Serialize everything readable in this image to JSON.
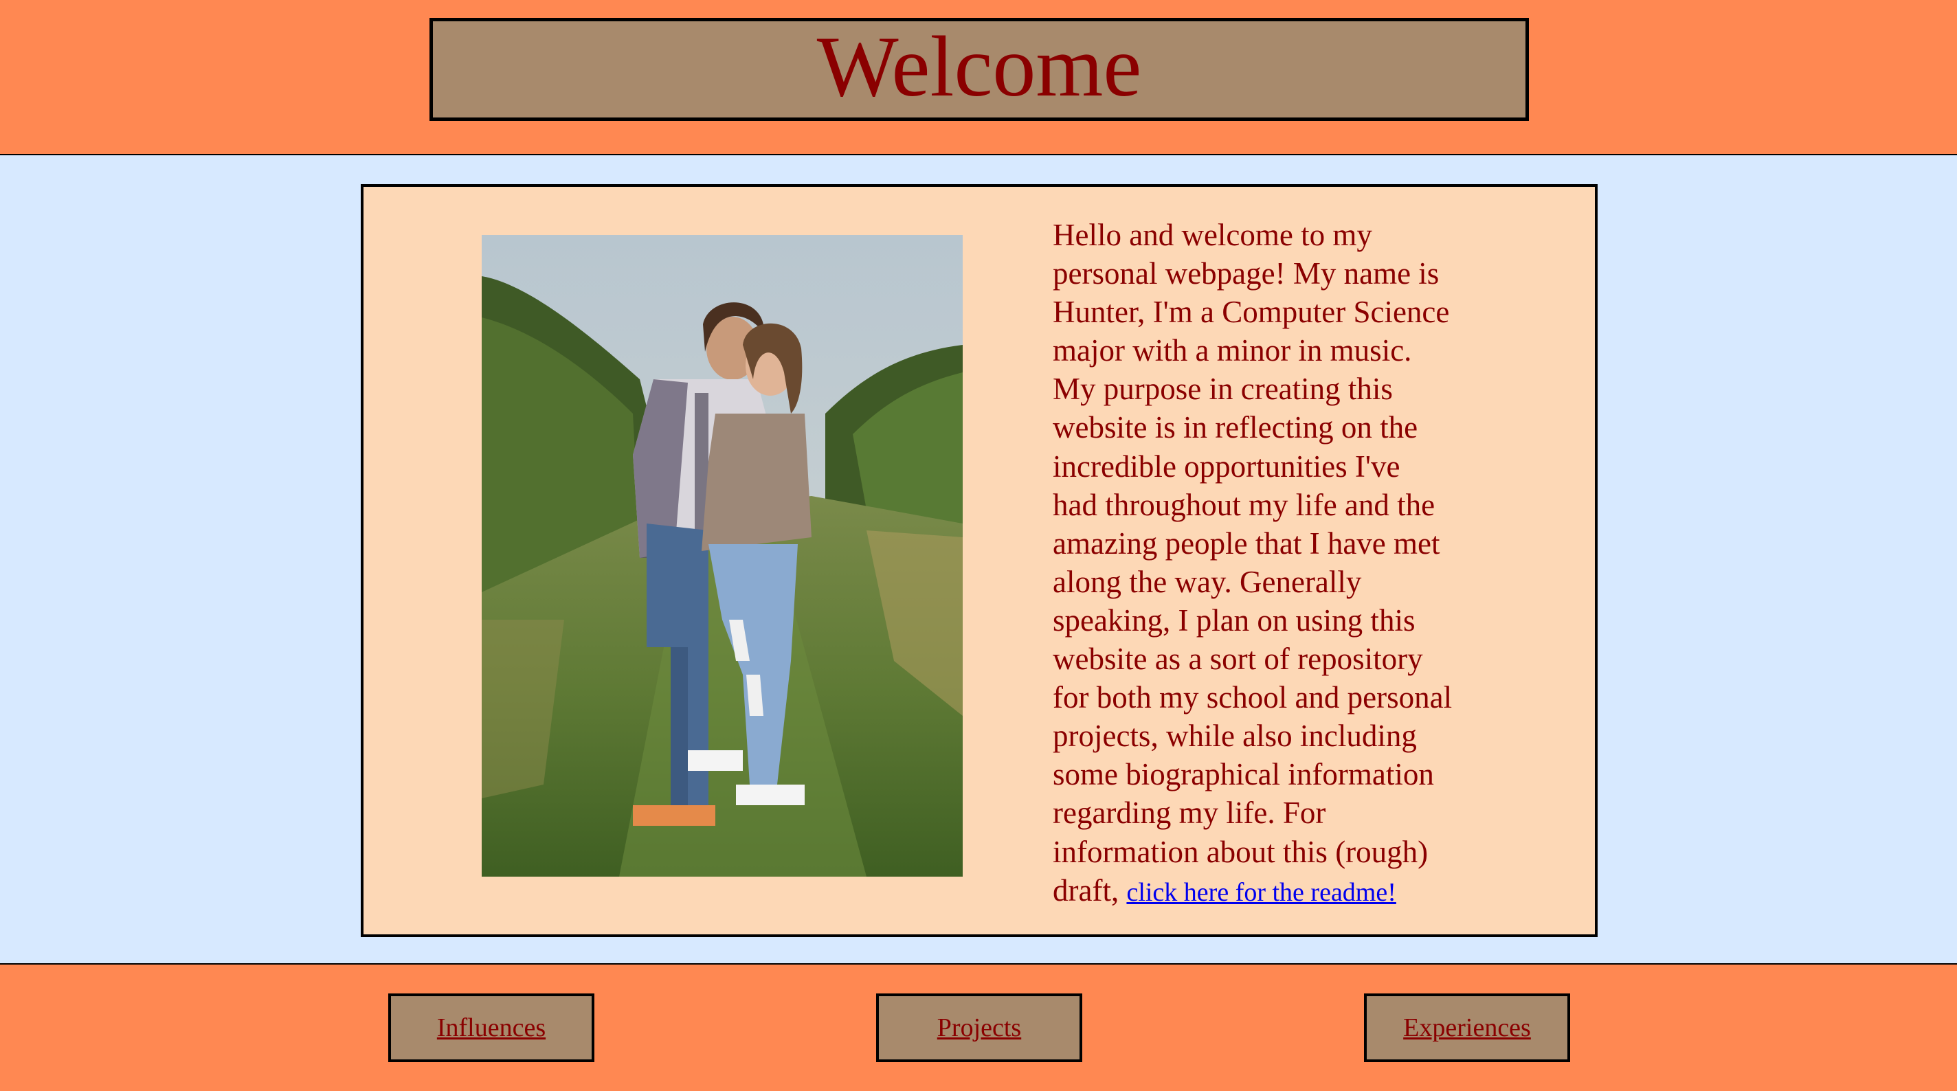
{
  "header": {
    "title": "Welcome"
  },
  "intro": {
    "photo_alt": "Photo of two people hugging in a vineyard",
    "bio_lines": [
      "Hello and welcome to my",
      "personal webpage! My name is",
      "Hunter, I'm a Computer Science",
      "major with a minor in music.",
      "My purpose in creating this",
      "website is in reflecting on the",
      "incredible opportunities I've",
      "had throughout my life and the",
      "amazing people that I have met",
      "along the way. Generally",
      "speaking, I plan on using this",
      "website as a sort of repository",
      "for both my school and personal",
      "projects, while also including",
      "some biographical information",
      "regarding my life. For",
      "information about this (rough)"
    ],
    "last_line_prefix": "draft, ",
    "readme_link": "click here for the readme!"
  },
  "nav": {
    "items": [
      {
        "label": "Influences"
      },
      {
        "label": "Projects"
      },
      {
        "label": "Experiences"
      }
    ]
  },
  "colors": {
    "header_bg": "#ff8852",
    "main_bg": "#d7e9ff",
    "card_bg": "#fdd8b6",
    "box_bg": "#a88a6c",
    "text": "#8a0000",
    "link": "#0000ee"
  }
}
